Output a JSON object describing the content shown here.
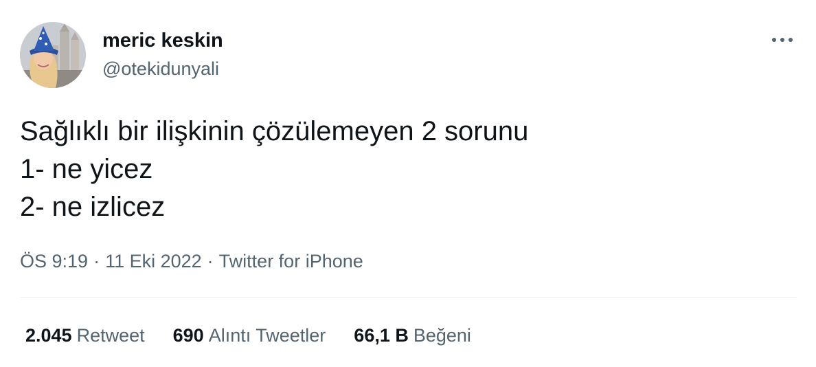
{
  "author": {
    "name": "meric keskin",
    "handle": "@otekidunyali",
    "avatar_icon": "profile-photo-icon"
  },
  "more_icon": "more-horizontal-icon",
  "tweet": {
    "text": "Sağlıklı bir ilişkinin çözülemeyen 2 sorunu\n1- ne yicez\n2- ne izlicez",
    "time": "ÖS 9:19",
    "date": "11 Eki 2022",
    "source": "Twitter for iPhone",
    "separator": "·"
  },
  "stats": {
    "retweets": {
      "count": "2.045",
      "label": "Retweet"
    },
    "quotes": {
      "count": "690",
      "label": "Alıntı Tweetler"
    },
    "likes": {
      "count": "66,1 B",
      "label": "Beğeni"
    }
  },
  "colors": {
    "text_primary": "#0f1419",
    "text_secondary": "#536471",
    "divider": "#eff3f4"
  }
}
